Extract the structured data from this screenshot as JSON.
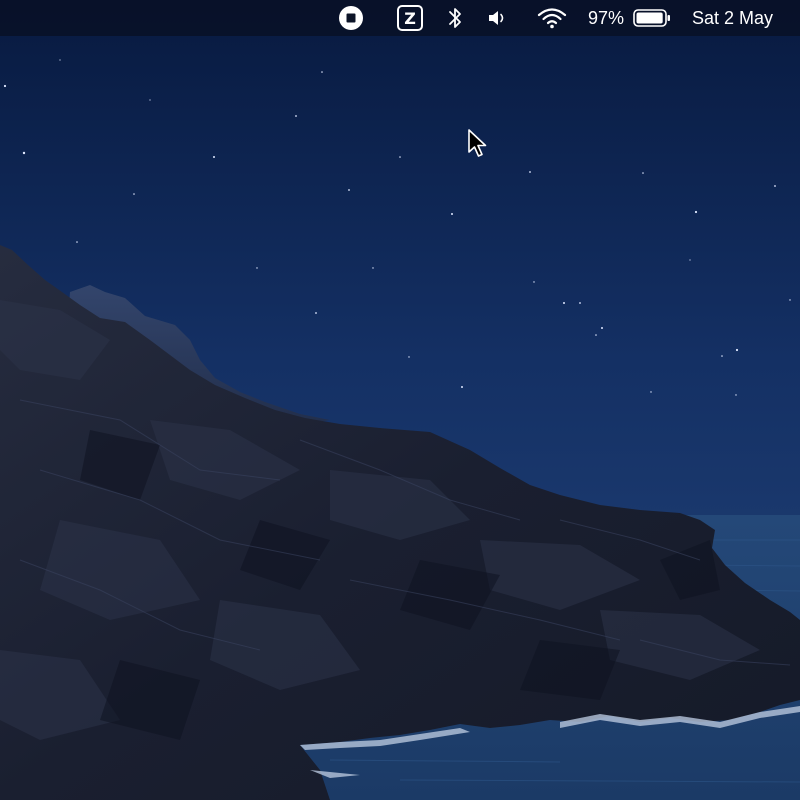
{
  "menubar": {
    "status_items": [
      {
        "name": "record-stop-icon"
      },
      {
        "name": "z-app-icon",
        "letter": "Z"
      },
      {
        "name": "bluetooth-icon"
      },
      {
        "name": "volume-icon"
      },
      {
        "name": "wifi-icon"
      }
    ],
    "battery_percent": "97%",
    "battery_level": 0.97,
    "clock": "Sat 2 May"
  },
  "desktop": {
    "wallpaper": "night-coastline-cliffs",
    "colors": {
      "sky_top": "#0b1d45",
      "sky_bottom": "#1f3f74",
      "rock": "#1c2236",
      "sea": "#16345f",
      "foam": "#c9d6e8"
    }
  },
  "cursor": {
    "name": "arrow-pointer"
  }
}
